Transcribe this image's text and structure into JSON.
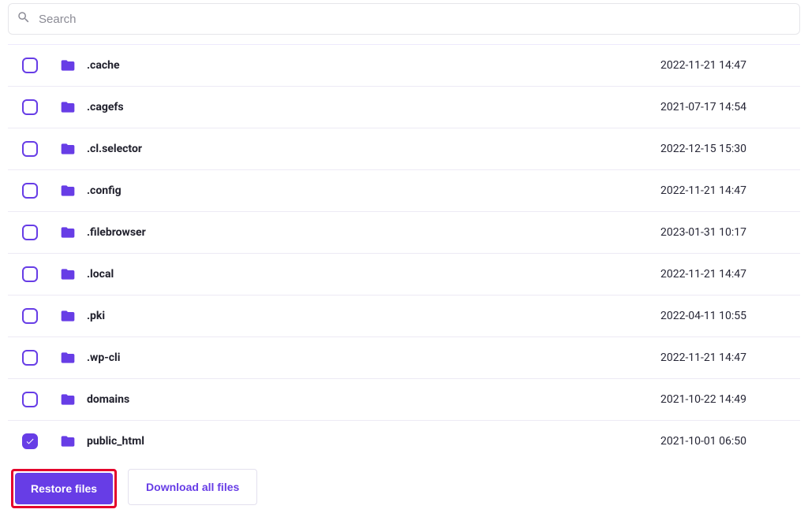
{
  "search": {
    "placeholder": "Search",
    "value": ""
  },
  "colors": {
    "accent": "#673de6",
    "highlight_box": "#e4002b"
  },
  "files": [
    {
      "name": ".cache",
      "date": "2022-11-21 14:47",
      "checked": false
    },
    {
      "name": ".cagefs",
      "date": "2021-07-17 14:54",
      "checked": false
    },
    {
      "name": ".cl.selector",
      "date": "2022-12-15 15:30",
      "checked": false
    },
    {
      "name": ".config",
      "date": "2022-11-21 14:47",
      "checked": false
    },
    {
      "name": ".filebrowser",
      "date": "2023-01-31 10:17",
      "checked": false
    },
    {
      "name": ".local",
      "date": "2022-11-21 14:47",
      "checked": false
    },
    {
      "name": ".pki",
      "date": "2022-04-11 10:55",
      "checked": false
    },
    {
      "name": ".wp-cli",
      "date": "2022-11-21 14:47",
      "checked": false
    },
    {
      "name": "domains",
      "date": "2021-10-22 14:49",
      "checked": false
    },
    {
      "name": "public_html",
      "date": "2021-10-01 06:50",
      "checked": true
    }
  ],
  "footer": {
    "restore_label": "Restore files",
    "download_label": "Download all files"
  }
}
